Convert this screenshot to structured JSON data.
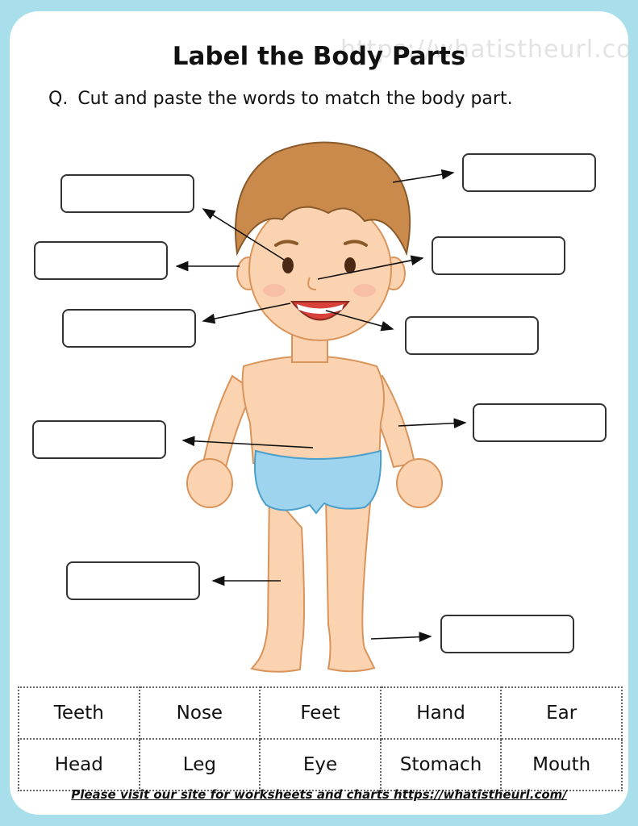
{
  "title": "Label the Body Parts",
  "watermark": "https://whatistheurl.com",
  "question": {
    "prefix": "Q.",
    "text": "Cut and paste the words to match the body part."
  },
  "word_bank": {
    "row1": [
      "Teeth",
      "Nose",
      "Feet",
      "Hand",
      "Ear"
    ],
    "row2": [
      "Head",
      "Leg",
      "Eye",
      "Stomach",
      "Mouth"
    ]
  },
  "footer": "Please visit our site for worksheets and charts https://whatistheurl.com/",
  "colors": {
    "page_border": "#a9dfeb",
    "skin": "#fbd3b0",
    "hair": "#c98a4b",
    "diaper": "#9fd4ef"
  }
}
